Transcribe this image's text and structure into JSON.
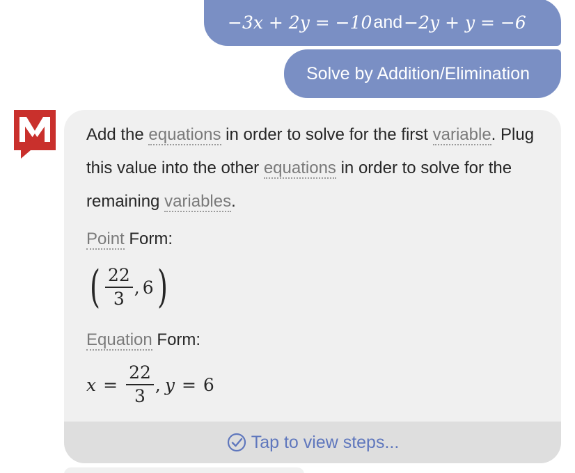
{
  "user_messages": {
    "equation": {
      "lhs1": "−3x + 2y = −10",
      "connector": "and",
      "lhs2": "−2y + y = −6"
    },
    "solve_label": "Solve by Addition/Elimination"
  },
  "answer": {
    "intro": {
      "part1": "Add the ",
      "term_equations": "equations",
      "part2": " in order to solve for the first ",
      "term_variable": "variable",
      "part3": ". Plug this value into the other ",
      "term_equations2": "equations",
      "part4": " in order to solve for the remaining ",
      "term_variables": "variables",
      "part5": "."
    },
    "point_form": {
      "term": "Point",
      "label_rest": " Form:",
      "open": "(",
      "numerator": "22",
      "denominator": "3",
      "sep": ",",
      "y_value": "6",
      "close": ")"
    },
    "equation_form": {
      "term": "Equation",
      "label_rest": " Form:",
      "x_var": "x",
      "equals": "=",
      "numerator": "22",
      "denominator": "3",
      "sep": ",",
      "y_var": "y",
      "equals2": "=",
      "y_value": "6"
    },
    "steps_label": "Tap to view steps..."
  },
  "colors": {
    "user_bubble": "#7a8fc4",
    "brand_red": "#c9302c",
    "link_blue": "#5f77bd",
    "card_bg": "#f0f0f0"
  },
  "icons": {
    "avatar": "mathway-logo-icon",
    "steps": "check-circle-icon"
  }
}
